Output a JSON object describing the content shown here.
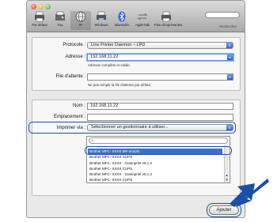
{
  "toolbar": {
    "items": [
      {
        "label": "Par défaut",
        "icon": "printer-default-icon"
      },
      {
        "label": "Fax",
        "icon": "fax-icon"
      },
      {
        "label": "IP",
        "icon": "ip-globe-icon",
        "selected": true
      },
      {
        "label": "Windows",
        "icon": "windows-printer-icon"
      },
      {
        "label": "Bluetooth",
        "icon": "bluetooth-icon"
      },
      {
        "label": "AppleTalk",
        "icon": "appletalk-icon"
      },
      {
        "label": "Plus d'imprimantes",
        "icon": "more-printers-icon"
      }
    ],
    "search_label": "Rechercher"
  },
  "form1": {
    "protocol_label": "Protocole :",
    "protocol_value": "Line Printer Daemon – LPD",
    "address_label": "Adresse :",
    "address_value": "192.168.11.22",
    "address_hint": "Adresse complète et valide.",
    "queue_label": "File d'attente :",
    "queue_value": "",
    "queue_hint": "Ne pas remplir la file d'attente par défaut."
  },
  "form2": {
    "name_label": "Nom :",
    "name_value": "192.168.11.22",
    "location_label": "Emplacement :",
    "location_value": "",
    "print_via_label": "Imprimer via :",
    "print_via_value": "Sélectionner un gestionnaire à utiliser..."
  },
  "driver_list": {
    "search_value": "",
    "rows": [
      {
        "label": "Brother MFC- XXXX BR-Script3",
        "selected": true
      },
      {
        "label": "Brother MFC- XXXX CUPS",
        "selected": false
      },
      {
        "label": "Brother MFC- XXXX - Gutenprint v5.1.3",
        "selected": false
      },
      {
        "label": "Brother MFC- XXXX CUPS",
        "selected": false
      },
      {
        "label": "Brother MFC- XXXX - Gutenprint v5.1.3",
        "selected": false
      },
      {
        "label": "Brother MFC- XXXX CUPS",
        "selected": false
      }
    ]
  },
  "actions": {
    "add_label": "Ajouter"
  },
  "colors": {
    "accent": "#1a4fa6",
    "selection": "#3d6fc4",
    "arrow": "#1a4fa6"
  }
}
